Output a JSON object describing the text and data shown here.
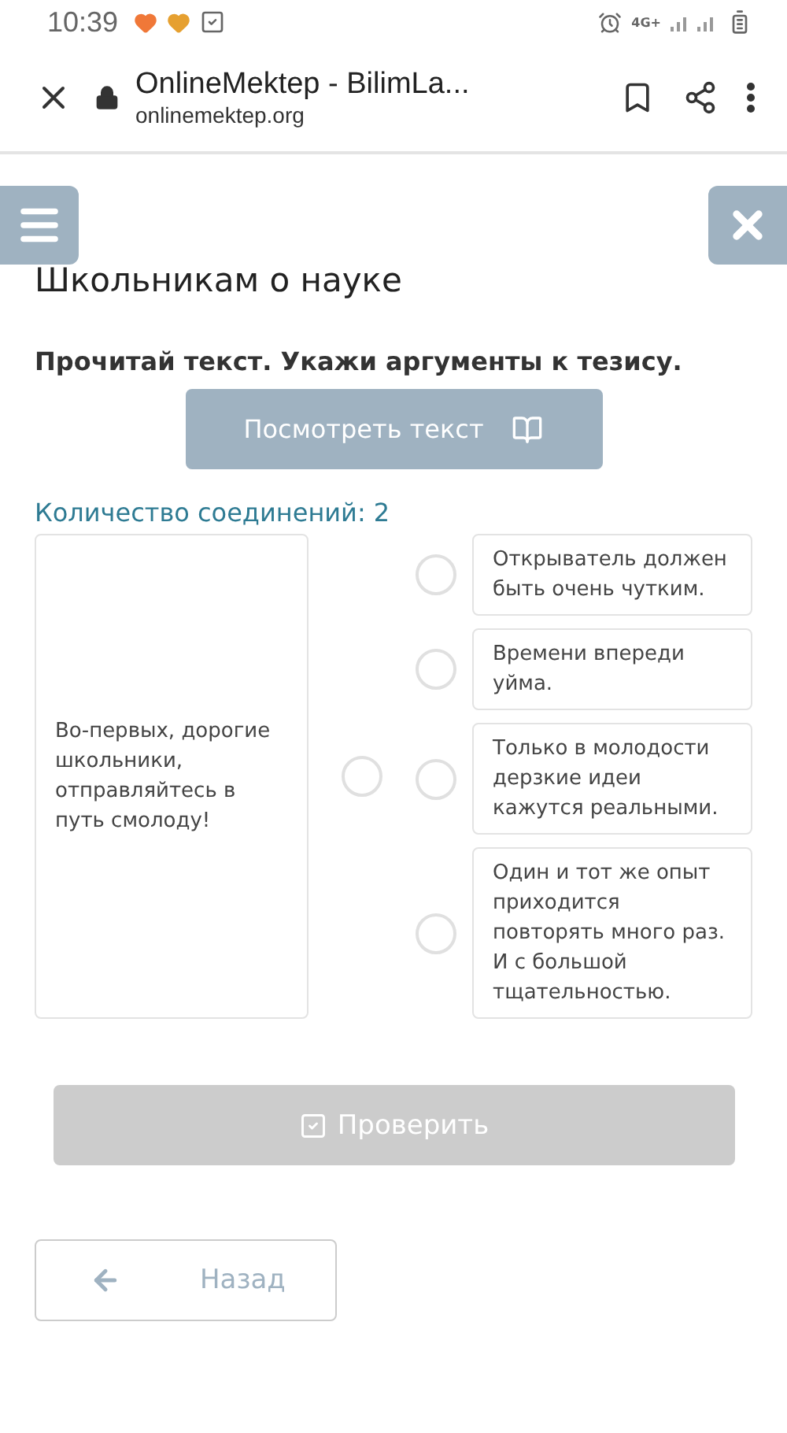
{
  "status_bar": {
    "time": "10:39",
    "network": "4G+"
  },
  "browser": {
    "title": "OnlineMektep - BilimLa...",
    "url": "onlinemektep.org"
  },
  "page": {
    "title": "Школьникам о науке",
    "instruction": "Прочитай текст. Укажи аргументы к тезису.",
    "view_text_button": "Посмотреть текст",
    "connections_label": "Количество соединений: 2"
  },
  "left_items": [
    {
      "text": "Во-первых, дорогие школьники, отправляйтесь в путь смолоду!",
      "selected": false
    }
  ],
  "right_items": [
    {
      "text": "Открыватель должен быть очень чутким.",
      "selected": false
    },
    {
      "text": "Времени впереди уйма.",
      "selected": false
    },
    {
      "text": "Только в молодости дерзкие идеи кажутся реальными.",
      "selected": false
    },
    {
      "text": "Один и тот же опыт приходится повторять много раз. И с большой тщательностью.",
      "selected": false
    }
  ],
  "check_button": {
    "label": "Проверить",
    "disabled": true
  },
  "back_button": {
    "label": "Назад"
  }
}
